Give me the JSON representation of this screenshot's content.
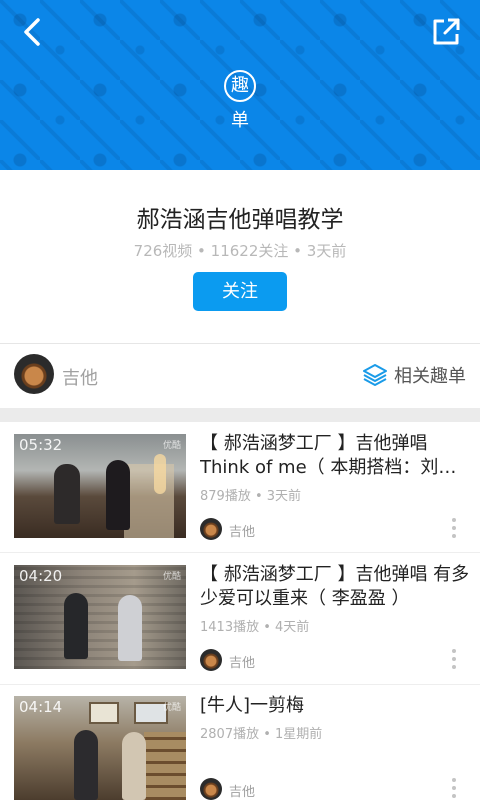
{
  "header": {
    "badge_char": "趣",
    "badge_sub": "单",
    "back_icon": "chevron-left-icon",
    "share_icon": "external-share-icon",
    "color": "#0b86e8"
  },
  "playlist": {
    "title": "郝浩涵吉他弹唱教学",
    "meta": "726视频 • 11622关注 • 3天前",
    "follow_label": "关注",
    "follow_color": "#0b9bf0"
  },
  "author": {
    "name": "吉他",
    "related_label": "相关趣单",
    "related_icon": "layers-icon"
  },
  "videos": [
    {
      "duration": "05:32",
      "watermark": "优酷",
      "title": "【 郝浩涵梦工厂 】吉他弹唱 Think of me（ 本期搭档：刘…",
      "stats": "879播放 • 3天前",
      "author": "吉他"
    },
    {
      "duration": "04:20",
      "watermark": "优酷",
      "title": "【 郝浩涵梦工厂 】吉他弹唱 有多少爱可以重来（ 李盈盈 ）",
      "stats": "1413播放 • 4天前",
      "author": "吉他"
    },
    {
      "duration": "04:14",
      "watermark": "优酷",
      "title": "[牛人]一剪梅",
      "stats": "2807播放 • 1星期前",
      "author": "吉他"
    }
  ]
}
